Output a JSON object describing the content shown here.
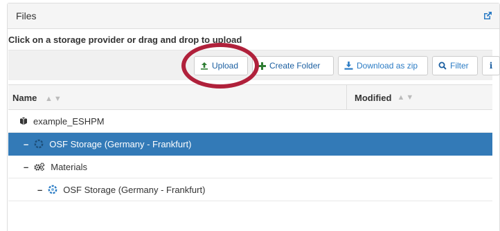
{
  "panel": {
    "title": "Files"
  },
  "instructions": "Click on a storage provider or drag and drop to upload",
  "toolbar": {
    "upload_label": "Upload",
    "create_folder_label": "Create Folder",
    "download_zip_label": "Download as zip",
    "filter_label": "Filter",
    "info_label": "i"
  },
  "columns": {
    "name": "Name",
    "modified": "Modified"
  },
  "rows": [
    {
      "label": "example_ESHPM",
      "toggle": "",
      "icon": "cube-icon",
      "selected": false
    },
    {
      "label": "OSF Storage (Germany - Frankfurt)",
      "toggle": "–",
      "icon": "osf-storage-icon",
      "selected": true
    },
    {
      "label": "Materials",
      "toggle": "–",
      "icon": "cogs-icon",
      "selected": false
    },
    {
      "label": "OSF Storage (Germany - Frankfurt)",
      "toggle": "–",
      "icon": "osf-storage-icon",
      "selected": false
    }
  ],
  "colors": {
    "selected_row": "#337ab7",
    "highlight_ring": "#b0213b",
    "upload_icon": "#2e7d32",
    "create_icon": "#2e7d32",
    "osf_icon": "#2a7bc4"
  }
}
